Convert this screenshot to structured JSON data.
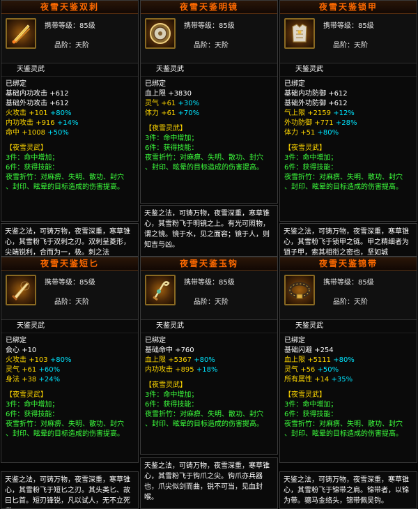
{
  "cards": [
    {
      "title": "夜雪天鉴双刺",
      "icon": "twin-daggers-icon",
      "req_label": "携带等级：",
      "req_value": "85级",
      "grade_label": "品阶：",
      "grade_value": "天阶",
      "subtitle": "天鉴灵武",
      "bound": "已绑定",
      "stats": [
        {
          "name": "基础内功攻击",
          "value": "+612",
          "bonus": "",
          "cls": "w"
        },
        {
          "name": "基础外功攻击",
          "value": "+612",
          "bonus": "",
          "cls": "w"
        },
        {
          "name": "火攻击",
          "value": "+101",
          "bonus": "+80%",
          "cls": "y"
        },
        {
          "name": "内功攻击",
          "value": "+916",
          "bonus": "+14%",
          "cls": "y"
        },
        {
          "name": "命中",
          "value": "+1008",
          "bonus": "+50%",
          "cls": "y"
        }
      ],
      "set_title": "【夜雪灵武】",
      "set_lines": [
        "3件：命中增加；",
        "6件：获得技能：",
        "夜雪折竹：对麻痹、失明、散功、封穴",
        "、封印、眩晕的目标造成的伤害提高。"
      ],
      "desc": "天鉴之法，可铸万物，夜雪深重，寒草锥心，其雪粉飞于双刺之刃。双刺呈菱形，尖端锐利，合而为一，极。刺之法"
    },
    {
      "title": "夜雪天鉴明镜",
      "icon": "bright-mirror-icon",
      "req_label": "携带等级：",
      "req_value": "85级",
      "grade_label": "品阶：",
      "grade_value": "天阶",
      "subtitle": "天鉴灵武",
      "bound": "已绑定",
      "stats": [
        {
          "name": "血上限",
          "value": "+3830",
          "bonus": "",
          "cls": "w"
        },
        {
          "name": "灵气",
          "value": "+61",
          "bonus": "+30%",
          "cls": "y"
        },
        {
          "name": "体力",
          "value": "+61",
          "bonus": "+70%",
          "cls": "y"
        }
      ],
      "set_title": "【夜雪灵武】",
      "set_lines": [
        "3件：命中增加；",
        "6件：获得技能：",
        "夜雪折竹：对麻痹、失明、散功、封穴",
        "、封印、眩晕的目标造成的伤害提高。"
      ],
      "desc": "天鉴之法，可铸万物，夜雪深重，寒草锥心，其雪粉飞于明镜之上。有光可照物，谓之镜。镜于水，见之面容；镜于人，则知吉与凶。"
    },
    {
      "title": "夜雪天鉴锁甲",
      "icon": "chain-armor-icon",
      "req_label": "携带等级：",
      "req_value": "85级",
      "grade_label": "品阶：",
      "grade_value": "天阶",
      "subtitle": "天鉴灵武",
      "bound": "已绑定",
      "stats": [
        {
          "name": "基础内功防御",
          "value": "+612",
          "bonus": "",
          "cls": "w"
        },
        {
          "name": "基础外功防御",
          "value": "+612",
          "bonus": "",
          "cls": "w"
        },
        {
          "name": "气上限",
          "value": "+2159",
          "bonus": "+12%",
          "cls": "y"
        },
        {
          "name": "外功防御",
          "value": "+771",
          "bonus": "+28%",
          "cls": "y"
        },
        {
          "name": "体力",
          "value": "+51",
          "bonus": "+80%",
          "cls": "y"
        }
      ],
      "set_title": "【夜雪灵武】",
      "set_lines": [
        "3件：命中增加；",
        "6件：获得技能：",
        "夜雪折竹：对麻痹、失明、散功、封穴",
        "、封印、眩晕的目标造成的伤害提高。"
      ],
      "desc": "天鉴之法，可铸万物，夜雪深重，寒草锥心，其雪粉飞于锁甲之链。甲之精细者为锁子甲，索其相衔之密也，坚如城"
    },
    {
      "title": "夜雪天鉴短匕",
      "icon": "short-dagger-icon",
      "req_label": "携带等级：",
      "req_value": "85级",
      "grade_label": "品阶：",
      "grade_value": "天阶",
      "subtitle": "天鉴灵武",
      "bound": "已绑定",
      "stats": [
        {
          "name": "会心",
          "value": "+10",
          "bonus": "",
          "cls": "w"
        },
        {
          "name": "火攻击",
          "value": "+103",
          "bonus": "+80%",
          "cls": "y"
        },
        {
          "name": "灵气",
          "value": "+61",
          "bonus": "+60%",
          "cls": "y"
        },
        {
          "name": "身法",
          "value": "+38",
          "bonus": "+24%",
          "cls": "y"
        }
      ],
      "set_title": "【夜雪灵武】",
      "set_lines": [
        "3件：命中增加；",
        "6件：获得技能：",
        "夜雪折竹：对麻痹、失明、散功、封穴",
        "、封印、眩晕的目标造成的伤害提高。"
      ],
      "desc": "天鉴之法，可铸万物，夜雪深重，寒草锥心，其雪粉飞于短匕之刃。其头类匕、故曰匕首。短刃锋锐，凡以试人，无不立死者。"
    },
    {
      "title": "夜雪天鉴玉钩",
      "icon": "jade-hook-icon",
      "req_label": "携带等级：",
      "req_value": "85级",
      "grade_label": "品阶：",
      "grade_value": "天阶",
      "subtitle": "天鉴灵武",
      "bound": "已绑定",
      "stats": [
        {
          "name": "基础命中",
          "value": "+760",
          "bonus": "",
          "cls": "w"
        },
        {
          "name": "血上限",
          "value": "+5367",
          "bonus": "+80%",
          "cls": "y"
        },
        {
          "name": "内功攻击",
          "value": "+895",
          "bonus": "+18%",
          "cls": "y"
        }
      ],
      "set_title": "【夜雪灵武】",
      "set_lines": [
        "3件：命中增加；",
        "6件：获得技能：",
        "夜雪折竹：对麻痹、失明、散功、封穴",
        "、封印、眩晕的目标造成的伤害提高。"
      ],
      "desc": "天鉴之法，可铸万物，夜雪深重，寒草锥心，其雪粉飞于钩爪之尖。钩爪亦兵器也，爪尖似剑而曲，锐不可当，见血封喉。"
    },
    {
      "title": "夜雪天鉴锦带",
      "icon": "brocade-belt-icon",
      "req_label": "携带等级：",
      "req_value": "85级",
      "grade_label": "品阶：",
      "grade_value": "天阶",
      "subtitle": "天鉴灵武",
      "bound": "已绑定",
      "stats": [
        {
          "name": "基础闪避",
          "value": "+254",
          "bonus": "",
          "cls": "w"
        },
        {
          "name": "血上限",
          "value": "+5111",
          "bonus": "+80%",
          "cls": "y"
        },
        {
          "name": "灵气",
          "value": "+56",
          "bonus": "+50%",
          "cls": "y"
        },
        {
          "name": "所有属性",
          "value": "+14",
          "bonus": "+35%",
          "cls": "y"
        }
      ],
      "set_title": "【夜雪灵武】",
      "set_lines": [
        "3件：命中增加；",
        "6件：获得技能：",
        "夜雪折竹：对麻痹、失明、散功、封穴",
        "、封印、眩晕的目标造成的伤害提高。"
      ],
      "desc": "天鉴之法，可铸万物，夜雪深重，寒草锥心，其雪粉飞于锦带之肩。锦带者，以锦为带。骢马金络头，锦带佩吴钩。"
    }
  ]
}
